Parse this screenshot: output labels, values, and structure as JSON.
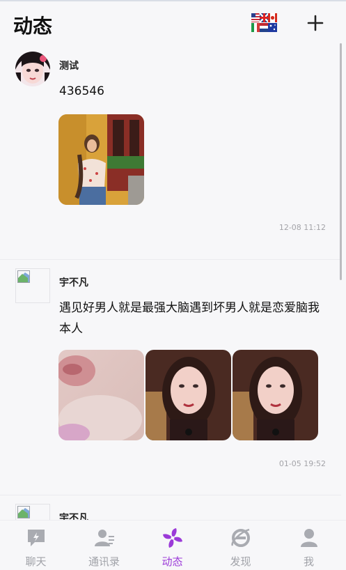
{
  "header": {
    "title": "动态"
  },
  "posts": [
    {
      "name": "测试",
      "text": "436546",
      "time": "12-08 11:12"
    },
    {
      "name": "宇不凡",
      "text": "遇见好男人就是最强大脑遇到坏男人就是恋爱脑我本人",
      "time": "01-05 19:52"
    },
    {
      "name": "宇不凡"
    }
  ],
  "tabs": [
    {
      "label": "聊天",
      "icon": "chat-icon"
    },
    {
      "label": "通讯录",
      "icon": "contacts-icon"
    },
    {
      "label": "动态",
      "icon": "moments-icon"
    },
    {
      "label": "发现",
      "icon": "discover-icon"
    },
    {
      "label": "我",
      "icon": "profile-icon"
    }
  ],
  "colors": {
    "accent": "#9b3ad8",
    "inactive": "#a0a2a8",
    "background": "#f7f7f9"
  }
}
